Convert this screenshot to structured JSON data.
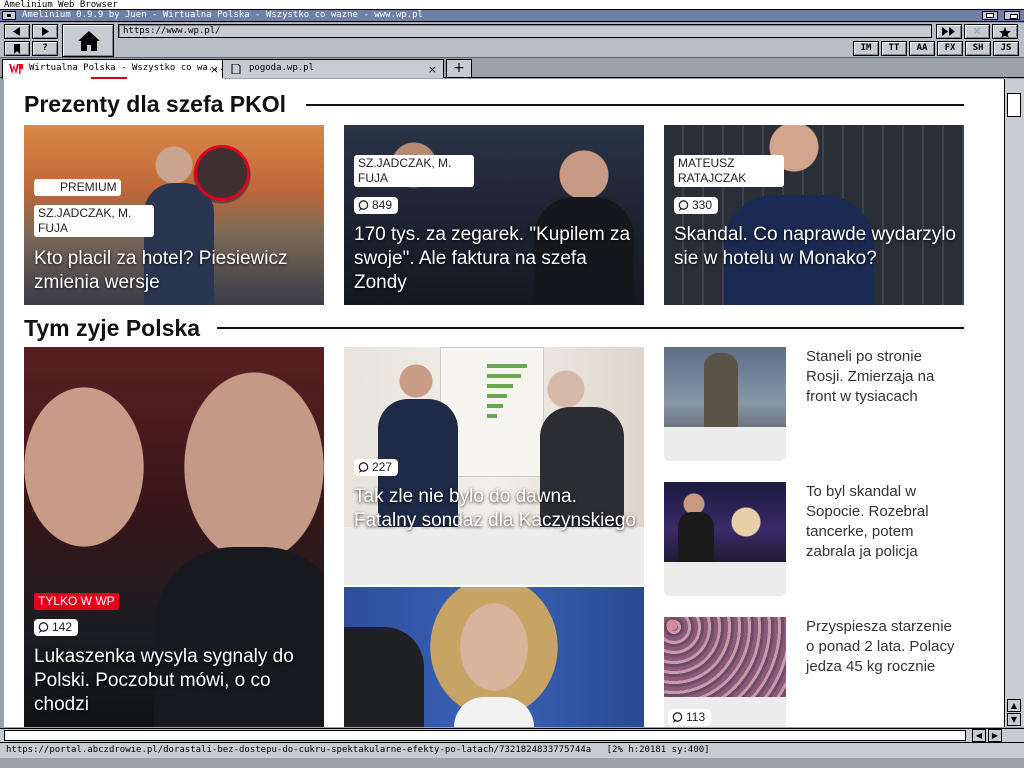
{
  "screen_title": "Amelinium Web Browser",
  "window_title": "Amelinium 0.9.9 by Juen - Wirtualna Polska - Wszystko co wazne - www.wp.pl",
  "toolbar": {
    "url": "https://www.wp.pl/",
    "help_label": "?",
    "mode_buttons": [
      "IM",
      "TT",
      "AA",
      "FX",
      "SH",
      "JS"
    ]
  },
  "tabs": [
    {
      "title": "Wirtualna Polska - Wszystko co wa..."
    },
    {
      "title": "pogoda.wp.pl"
    }
  ],
  "new_tab_label": "+",
  "sections": {
    "prezenty": {
      "title": "Prezenty dla szefa PKOl",
      "cards": [
        {
          "premium": "PREMIUM",
          "author": "SZ.JADCZAK, M. FUJA",
          "headline": "Kto placil za hotel? Piesiewicz zmienia wersje",
          "image": "tv-studio-two-men"
        },
        {
          "author": "SZ.JADCZAK, M. FUJA",
          "comments": "849",
          "headline": "170 tys. za zegarek. \"Kupilem za swoje\". Ale faktura na szefa Zondy",
          "image": "men-with-watch"
        },
        {
          "author": "MATEUSZ RATAJCZAK",
          "comments": "330",
          "headline": "Skandal. Co naprawde wydarzylo sie w hotelu w Monako?",
          "image": "man-in-suit-building"
        }
      ]
    },
    "tym_zyje": {
      "title": "Tym zyje Polska",
      "main": {
        "badge": "TYLKO W WP",
        "comments": "142",
        "headline": "Lukaszenka wysyla sygnaly do Polski. Poczobut mówi, o co chodzi",
        "image": "lukaszenka-poczobut"
      },
      "middle": {
        "comments": "227",
        "headline": "Tak zle nie bylo do dawna. Fatalny sondaz dla Kaczynskiego",
        "image": "morawiecki-kaczynski-poll"
      },
      "middle2": {
        "image": "woman-politician"
      },
      "side": [
        {
          "text": "Staneli po stronie Rosji.  Zmierzaja na front w tysiacach",
          "image": "soldier-monument"
        },
        {
          "text": "To byl skandal w Sopocie.  Rozebral tancerke, potem zabrala ja policja",
          "image": "stage-performance"
        },
        {
          "text": "Przyspiesza starzenie o ponad 2 lata. Polacy jedza 45 kg rocznie",
          "comments": "113",
          "image": "sugar-candies"
        }
      ]
    }
  },
  "status_url": "https://portal.abczdrowie.pl/dorastali-bez-dostepu-do-cukru-spektakularne-efekty-po-latach/7321824833775744a",
  "status_info": "[2% h:20181 sy:400]",
  "colors": {
    "wp_red": "#e3001b",
    "title_bar": "#6f7fa8",
    "chrome_gray": "#c7ccd3"
  }
}
